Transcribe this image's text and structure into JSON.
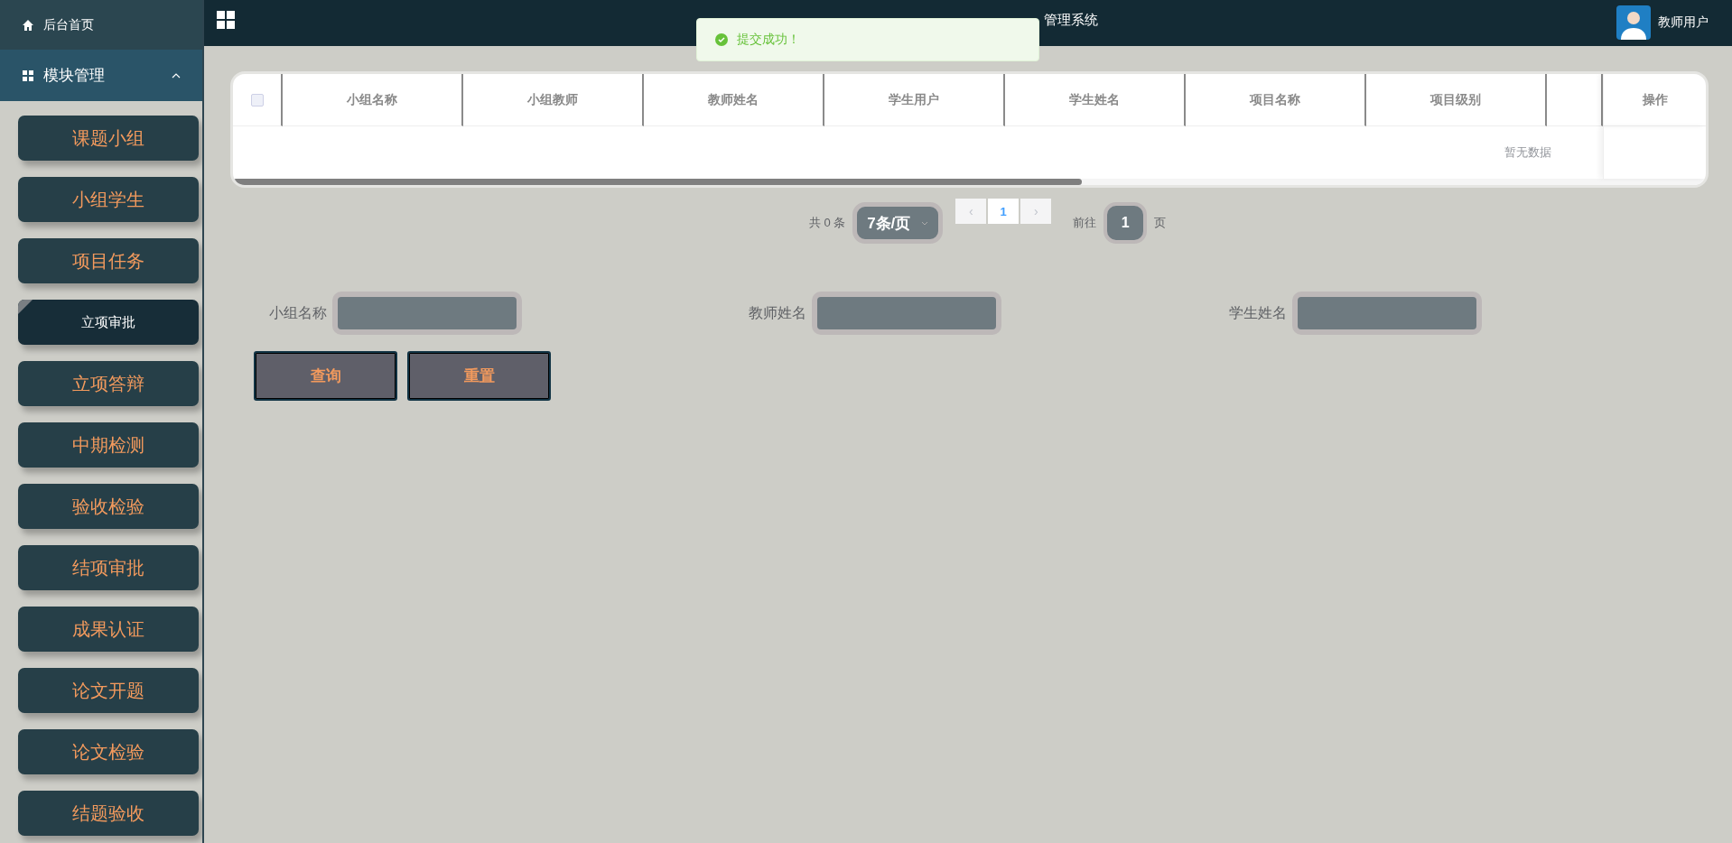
{
  "header": {
    "title": "管理系统",
    "user": "教师用户"
  },
  "toast": {
    "message": "提交成功！"
  },
  "sidebar": {
    "home": "后台首页",
    "section": {
      "label": "模块管理",
      "expanded": true
    },
    "items": [
      {
        "label": "课题小组",
        "selected": false
      },
      {
        "label": "小组学生",
        "selected": false
      },
      {
        "label": "项目任务",
        "selected": false
      },
      {
        "label": "立项审批",
        "selected": true
      },
      {
        "label": "立项答辩",
        "selected": false
      },
      {
        "label": "中期检测",
        "selected": false
      },
      {
        "label": "验收检验",
        "selected": false
      },
      {
        "label": "结项审批",
        "selected": false
      },
      {
        "label": "成果认证",
        "selected": false
      },
      {
        "label": "论文开题",
        "selected": false
      },
      {
        "label": "论文检验",
        "selected": false
      },
      {
        "label": "结题验收",
        "selected": false
      }
    ]
  },
  "table": {
    "select_all_checked": false,
    "columns": [
      "小组名称",
      "小组教师",
      "教师姓名",
      "学生用户",
      "学生姓名",
      "项目名称",
      "项目级别"
    ],
    "action_column": "操作",
    "empty_text": "暂无数据"
  },
  "pagination": {
    "total": "共 0 条",
    "page_size": "7条/页",
    "prev": "‹",
    "pages": [
      {
        "label": "1",
        "selected": true
      }
    ],
    "next": "›",
    "goto_label": "前往",
    "goto_value": "1",
    "page_suffix": "页"
  },
  "search": {
    "fields": [
      {
        "label": "小组名称"
      },
      {
        "label": "教师姓名"
      },
      {
        "label": "学生姓名"
      }
    ],
    "buttons": [
      "查询",
      "重置"
    ]
  }
}
